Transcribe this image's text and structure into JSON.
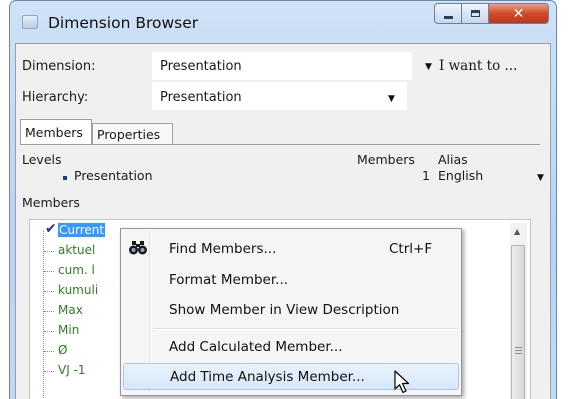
{
  "window": {
    "title": "Dimension Browser"
  },
  "form": {
    "dimension_label": "Dimension:",
    "dimension_value": "Presentation",
    "i_want_to_label": "I want to ...",
    "hierarchy_label": "Hierarchy:",
    "hierarchy_value": "Presentation"
  },
  "tabs": [
    {
      "label": "Members",
      "active": true
    },
    {
      "label": "Properties",
      "active": false
    }
  ],
  "levels": {
    "header": "Levels",
    "members_header": "Members",
    "alias_header": "Alias",
    "rows": [
      {
        "name": "Presentation",
        "members": "1",
        "alias": "English"
      }
    ]
  },
  "members_section": {
    "header": "Members",
    "items": [
      {
        "label": "Current",
        "checked": true,
        "selected": true
      },
      {
        "label": "aktuel",
        "checked": false,
        "selected": false
      },
      {
        "label": "cum. l",
        "checked": false,
        "selected": false
      },
      {
        "label": "kumuli",
        "checked": false,
        "selected": false
      },
      {
        "label": "Max",
        "checked": false,
        "selected": false
      },
      {
        "label": "Min",
        "checked": false,
        "selected": false
      },
      {
        "label": "Ø",
        "checked": false,
        "selected": false
      },
      {
        "label": "VJ -1",
        "checked": false,
        "selected": false
      }
    ]
  },
  "context_menu": {
    "items": [
      {
        "label": "Find Members...",
        "shortcut": "Ctrl+F",
        "icon": "binoculars-icon"
      },
      {
        "label": "Format Member...",
        "shortcut": ""
      },
      {
        "label": "Show Member in View Description",
        "shortcut": ""
      },
      {
        "label": "Add Calculated Member...",
        "shortcut": ""
      },
      {
        "label": "Add Time Analysis Member...",
        "shortcut": "",
        "hovered": true
      }
    ]
  },
  "colors": {
    "selection": "#3399ff",
    "member_text": "#2f7e23",
    "close_button": "#c2371a",
    "menu_hover": "#d7e7fa"
  }
}
